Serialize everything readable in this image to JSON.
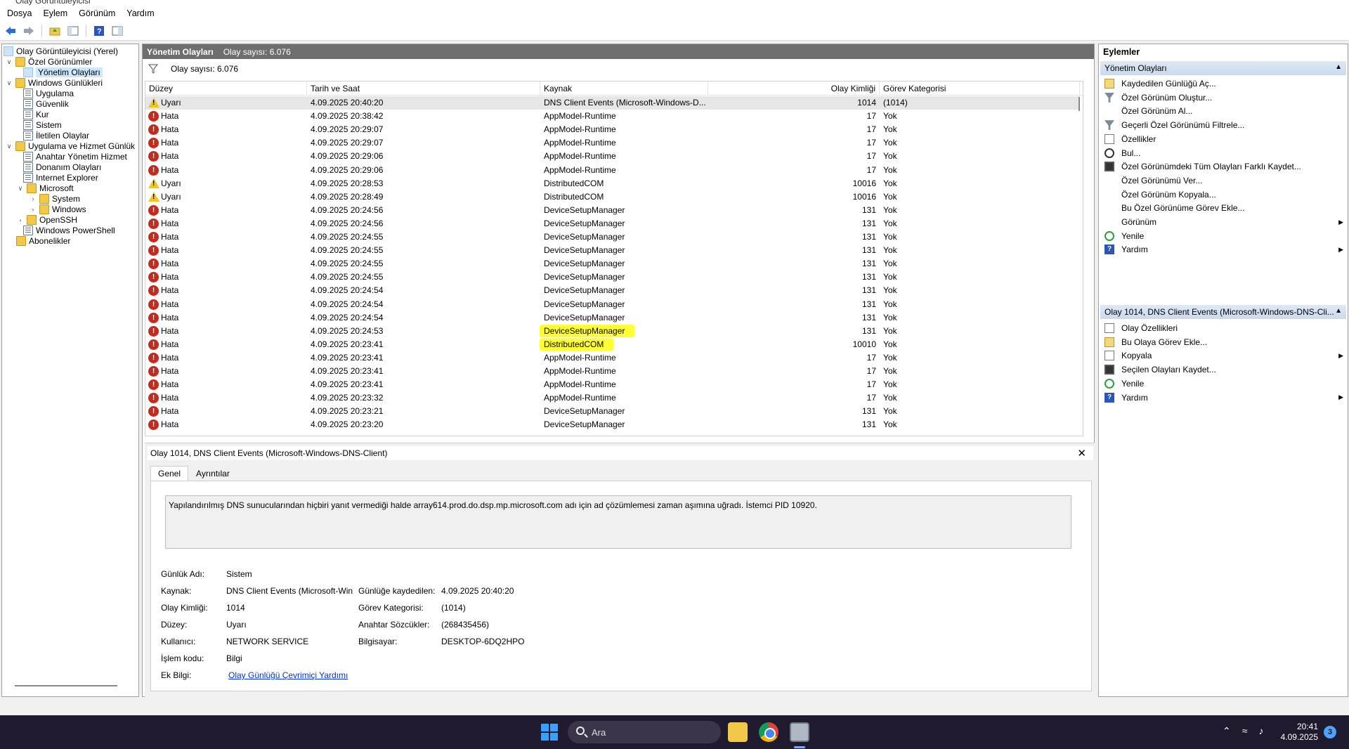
{
  "window": {
    "title": "Olay Görüntüleyicisi"
  },
  "menu": [
    "Dosya",
    "Eylem",
    "Görünüm",
    "Yardım"
  ],
  "tree": {
    "root": "Olay Görüntüleyicisi (Yerel)",
    "custom_views": "Özel Görünümler",
    "admin_events": "Yönetim Olayları",
    "windows_logs": "Windows Günlükleri",
    "logs": [
      "Uygulama",
      "Güvenlik",
      "Kur",
      "Sistem",
      "İletilen Olaylar"
    ],
    "app_service_logs": "Uygulama ve Hizmet Günlük",
    "app_logs": [
      "Anahtar Yönetim Hizmet",
      "Donanım Olayları",
      "Internet Explorer"
    ],
    "microsoft": "Microsoft",
    "ms_children": [
      "System",
      "Windows"
    ],
    "openssh": "OpenSSH",
    "powershell": "Windows PowerShell",
    "subscriptions": "Abonelikler"
  },
  "center": {
    "title": "Yönetim Olayları",
    "count_label": "Olay sayısı: 6.076",
    "filter_label": "Olay sayısı: 6.076",
    "columns": [
      "Düzey",
      "Tarih ve Saat",
      "Kaynak",
      "Olay Kimliği",
      "Görev Kategorisi"
    ],
    "rows": [
      {
        "level": "Uyarı",
        "type": "warn",
        "date": "4.09.2025 20:40:20",
        "source": "DNS Client Events (Microsoft-Windows-D...",
        "id": "1014",
        "cat": "(1014)"
      },
      {
        "level": "Hata",
        "type": "err",
        "date": "4.09.2025 20:38:42",
        "source": "AppModel-Runtime",
        "id": "17",
        "cat": "Yok"
      },
      {
        "level": "Hata",
        "type": "err",
        "date": "4.09.2025 20:29:07",
        "source": "AppModel-Runtime",
        "id": "17",
        "cat": "Yok"
      },
      {
        "level": "Hata",
        "type": "err",
        "date": "4.09.2025 20:29:07",
        "source": "AppModel-Runtime",
        "id": "17",
        "cat": "Yok"
      },
      {
        "level": "Hata",
        "type": "err",
        "date": "4.09.2025 20:29:06",
        "source": "AppModel-Runtime",
        "id": "17",
        "cat": "Yok"
      },
      {
        "level": "Hata",
        "type": "err",
        "date": "4.09.2025 20:29:06",
        "source": "AppModel-Runtime",
        "id": "17",
        "cat": "Yok"
      },
      {
        "level": "Uyarı",
        "type": "warn",
        "date": "4.09.2025 20:28:53",
        "source": "DistributedCOM",
        "id": "10016",
        "cat": "Yok"
      },
      {
        "level": "Uyarı",
        "type": "warn",
        "date": "4.09.2025 20:28:49",
        "source": "DistributedCOM",
        "id": "10016",
        "cat": "Yok"
      },
      {
        "level": "Hata",
        "type": "err",
        "date": "4.09.2025 20:24:56",
        "source": "DeviceSetupManager",
        "id": "131",
        "cat": "Yok"
      },
      {
        "level": "Hata",
        "type": "err",
        "date": "4.09.2025 20:24:56",
        "source": "DeviceSetupManager",
        "id": "131",
        "cat": "Yok"
      },
      {
        "level": "Hata",
        "type": "err",
        "date": "4.09.2025 20:24:55",
        "source": "DeviceSetupManager",
        "id": "131",
        "cat": "Yok"
      },
      {
        "level": "Hata",
        "type": "err",
        "date": "4.09.2025 20:24:55",
        "source": "DeviceSetupManager",
        "id": "131",
        "cat": "Yok"
      },
      {
        "level": "Hata",
        "type": "err",
        "date": "4.09.2025 20:24:55",
        "source": "DeviceSetupManager",
        "id": "131",
        "cat": "Yok"
      },
      {
        "level": "Hata",
        "type": "err",
        "date": "4.09.2025 20:24:55",
        "source": "DeviceSetupManager",
        "id": "131",
        "cat": "Yok"
      },
      {
        "level": "Hata",
        "type": "err",
        "date": "4.09.2025 20:24:54",
        "source": "DeviceSetupManager",
        "id": "131",
        "cat": "Yok"
      },
      {
        "level": "Hata",
        "type": "err",
        "date": "4.09.2025 20:24:54",
        "source": "DeviceSetupManager",
        "id": "131",
        "cat": "Yok"
      },
      {
        "level": "Hata",
        "type": "err",
        "date": "4.09.2025 20:24:54",
        "source": "DeviceSetupManager",
        "id": "131",
        "cat": "Yok"
      },
      {
        "level": "Hata",
        "type": "err",
        "date": "4.09.2025 20:24:53",
        "source": "DeviceSetupManager",
        "id": "131",
        "cat": "Yok",
        "highlight": true
      },
      {
        "level": "Hata",
        "type": "err",
        "date": "4.09.2025 20:23:41",
        "source": "DistributedCOM",
        "id": "10010",
        "cat": "Yok",
        "highlight": true
      },
      {
        "level": "Hata",
        "type": "err",
        "date": "4.09.2025 20:23:41",
        "source": "AppModel-Runtime",
        "id": "17",
        "cat": "Yok"
      },
      {
        "level": "Hata",
        "type": "err",
        "date": "4.09.2025 20:23:41",
        "source": "AppModel-Runtime",
        "id": "17",
        "cat": "Yok"
      },
      {
        "level": "Hata",
        "type": "err",
        "date": "4.09.2025 20:23:41",
        "source": "AppModel-Runtime",
        "id": "17",
        "cat": "Yok"
      },
      {
        "level": "Hata",
        "type": "err",
        "date": "4.09.2025 20:23:32",
        "source": "AppModel-Runtime",
        "id": "17",
        "cat": "Yok"
      },
      {
        "level": "Hata",
        "type": "err",
        "date": "4.09.2025 20:23:21",
        "source": "DeviceSetupManager",
        "id": "131",
        "cat": "Yok"
      },
      {
        "level": "Hata",
        "type": "err",
        "date": "4.09.2025 20:23:20",
        "source": "DeviceSetupManager",
        "id": "131",
        "cat": "Yok"
      }
    ]
  },
  "detail": {
    "header": "Olay 1014, DNS Client Events (Microsoft-Windows-DNS-Client)",
    "tabs": [
      "Genel",
      "Ayrıntılar"
    ],
    "description": "Yapılandırılmış DNS sunucularından hiçbiri yanıt vermediği halde array614.prod.do.dsp.mp.microsoft.com adı için ad çözümlemesi zaman aşımına uğradı. İstemci PID 10920.",
    "labels": {
      "log_name": "Günlük Adı:",
      "source": "Kaynak:",
      "event_id": "Olay Kimliği:",
      "level": "Düzey:",
      "user": "Kullanıcı:",
      "opcode": "İşlem kodu:",
      "more_info": "Ek Bilgi:",
      "logged": "Günlüğe kaydedilen:",
      "task_cat": "Görev Kategorisi:",
      "keywords": "Anahtar Sözcükler:",
      "computer": "Bilgisayar:"
    },
    "values": {
      "log_name": "Sistem",
      "source": "DNS Client Events (Microsoft-Win",
      "event_id": "1014",
      "level": "Uyarı",
      "user": "NETWORK SERVICE",
      "opcode": "Bilgi",
      "more_info": "Olay Günlüğü Çevrimiçi Yardımı",
      "logged": "4.09.2025 20:40:20",
      "task_cat": "(1014)",
      "keywords": "(268435456)",
      "computer": "DESKTOP-6DQ2HPO"
    }
  },
  "actions": {
    "title": "Eylemler",
    "section1": "Yönetim Olayları",
    "items1": [
      {
        "label": "Kaydedilen Günlüğü Aç...",
        "icon": "doc"
      },
      {
        "label": "Özel Görünüm Oluştur...",
        "icon": "funnel"
      },
      {
        "label": "Özel Görünüm Al...",
        "icon": "blank"
      },
      {
        "label": "Geçerli Özel Görünümü Filtrele...",
        "icon": "funnel"
      },
      {
        "label": "Özellikler",
        "icon": "props"
      },
      {
        "label": "Bul...",
        "icon": "find"
      },
      {
        "label": "Özel Görünümdeki Tüm Olayları Farklı Kaydet...",
        "icon": "save"
      },
      {
        "label": "Özel Görünümü Ver...",
        "icon": "blank"
      },
      {
        "label": "Özel Görünüm Kopyala...",
        "icon": "blank"
      },
      {
        "label": "Bu Özel Görünüme Görev Ekle...",
        "icon": "blank"
      },
      {
        "label": "Görünüm",
        "icon": "blank",
        "sub": true
      },
      {
        "label": "Yenile",
        "icon": "refresh"
      },
      {
        "label": "Yardım",
        "icon": "help",
        "sub": true
      }
    ],
    "section2": "Olay 1014, DNS Client Events (Microsoft-Windows-DNS-Cli...",
    "items2": [
      {
        "label": "Olay Özellikleri",
        "icon": "props"
      },
      {
        "label": "Bu Olaya Görev Ekle...",
        "icon": "doc"
      },
      {
        "label": "Kopyala",
        "icon": "props",
        "sub": true
      },
      {
        "label": "Seçilen Olayları Kaydet...",
        "icon": "save"
      },
      {
        "label": "Yenile",
        "icon": "refresh"
      },
      {
        "label": "Yardım",
        "icon": "help",
        "sub": true
      }
    ]
  },
  "taskbar": {
    "search": "Ara",
    "time": "20:41",
    "date": "4.09.2025",
    "notifications": "3"
  }
}
